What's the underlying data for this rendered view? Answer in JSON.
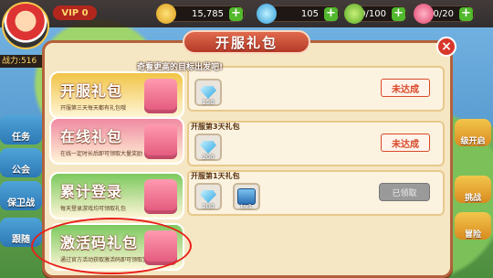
{
  "topbar": {
    "vip": "VIP 0",
    "coins": "15,785",
    "diamonds": "105",
    "energy": "100/100",
    "hearts": "20/20"
  },
  "left_sidebar": {
    "power_label": "战力:516",
    "items": [
      "任务",
      "公会",
      "保卫战",
      "跟随"
    ]
  },
  "right_sidebar": {
    "items": [
      "级开启",
      "挑战",
      "冒险"
    ]
  },
  "dialog": {
    "title": "开服礼包",
    "hint": "奇看更高的目标出发吧!",
    "close_label": "×"
  },
  "tabs": [
    {
      "name": "开服礼包",
      "desc": "开服第三天每天都有礼包哦",
      "color": "#f1c447"
    },
    {
      "name": "在线礼包",
      "desc": "在线一定时长后即可领取大量奖励",
      "color": "#f08aa2"
    },
    {
      "name": "累计登录",
      "desc": "每天登录游戏均可领取礼包",
      "color": "#7cc95e"
    },
    {
      "name": "激活码礼包",
      "desc": "通过官方活动获取激活码即可领取奖励",
      "color": "#7cc95e"
    }
  ],
  "packs": [
    {
      "title": "",
      "items": [
        {
          "qty": "150",
          "icon": "diamond-icon"
        }
      ],
      "status": "未达成"
    },
    {
      "title": "开服第3天礼包",
      "items": [
        {
          "qty": "200",
          "icon": "diamond-icon"
        }
      ],
      "status": "未达成"
    },
    {
      "title": "开服第1天礼包",
      "items": [
        {
          "qty": "100",
          "icon": "diamond-icon"
        },
        {
          "qty": "Lv1",
          "icon": "box-icon"
        }
      ],
      "status": "已领取"
    }
  ],
  "colors": {
    "accent": "#b2623b",
    "status_red": "#d84a2a",
    "claimed_gray": "#9a9a9a"
  }
}
